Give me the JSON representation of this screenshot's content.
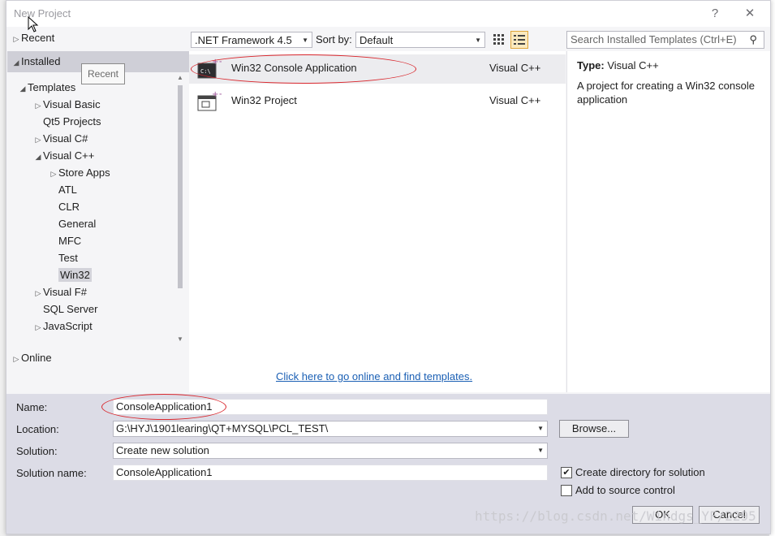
{
  "window": {
    "title": "New Project",
    "help_glyph": "?",
    "close_glyph": "✕"
  },
  "tree": {
    "recent": "Recent",
    "installed": "Installed",
    "tooltip": "Recent",
    "templates": "Templates",
    "items": [
      {
        "label": "Visual Basic",
        "level": 1,
        "arrow": "▷"
      },
      {
        "label": "Qt5 Projects",
        "level": 1,
        "arrow": ""
      },
      {
        "label": "Visual C#",
        "level": 1,
        "arrow": "▷"
      },
      {
        "label": "Visual C++",
        "level": 1,
        "arrow": "◢"
      },
      {
        "label": "Store Apps",
        "level": 2,
        "arrow": "▷"
      },
      {
        "label": "ATL",
        "level": 2,
        "arrow": ""
      },
      {
        "label": "CLR",
        "level": 2,
        "arrow": ""
      },
      {
        "label": "General",
        "level": 2,
        "arrow": ""
      },
      {
        "label": "MFC",
        "level": 2,
        "arrow": ""
      },
      {
        "label": "Test",
        "level": 2,
        "arrow": ""
      },
      {
        "label": "Win32",
        "level": 2,
        "arrow": "",
        "selected": true
      },
      {
        "label": "Visual F#",
        "level": 1,
        "arrow": "▷"
      },
      {
        "label": "SQL Server",
        "level": 1,
        "arrow": ""
      },
      {
        "label": "JavaScript",
        "level": 1,
        "arrow": "▷"
      }
    ],
    "online": "Online"
  },
  "toolbar": {
    "framework": ".NET Framework 4.5",
    "sort_label": "Sort by:",
    "sort_value": "Default",
    "search_placeholder": "Search Installed Templates (Ctrl+E)"
  },
  "templates": [
    {
      "name": "Win32 Console Application",
      "lang": "Visual C++",
      "selected": true
    },
    {
      "name": "Win32 Project",
      "lang": "Visual C++",
      "selected": false
    }
  ],
  "online_link": "Click here to go online and find templates.",
  "description": {
    "type_label": "Type:",
    "type_value": "Visual C++",
    "text": "A project for creating a Win32 console application"
  },
  "form": {
    "name_label": "Name:",
    "name_value": "ConsoleApplication1",
    "location_label": "Location:",
    "location_value": "G:\\HYJ\\1901learing\\QT+MYSQL\\PCL_TEST\\",
    "solution_label": "Solution:",
    "solution_value": "Create new solution",
    "solution_name_label": "Solution name:",
    "solution_name_value": "ConsoleApplication1",
    "browse": "Browse...",
    "create_dir_label": "Create directory for solution",
    "create_dir_checked": true,
    "source_control_label": "Add to source control",
    "source_control_checked": false,
    "ok": "OK",
    "cancel": "Cancel"
  },
  "watermark": "https://blog.csdn.net/Windgs_YF/2295",
  "colors": {
    "accent_link": "#1a5fb4",
    "annotation_red": "#d9262c",
    "selection_band": "#cfcfd7"
  }
}
